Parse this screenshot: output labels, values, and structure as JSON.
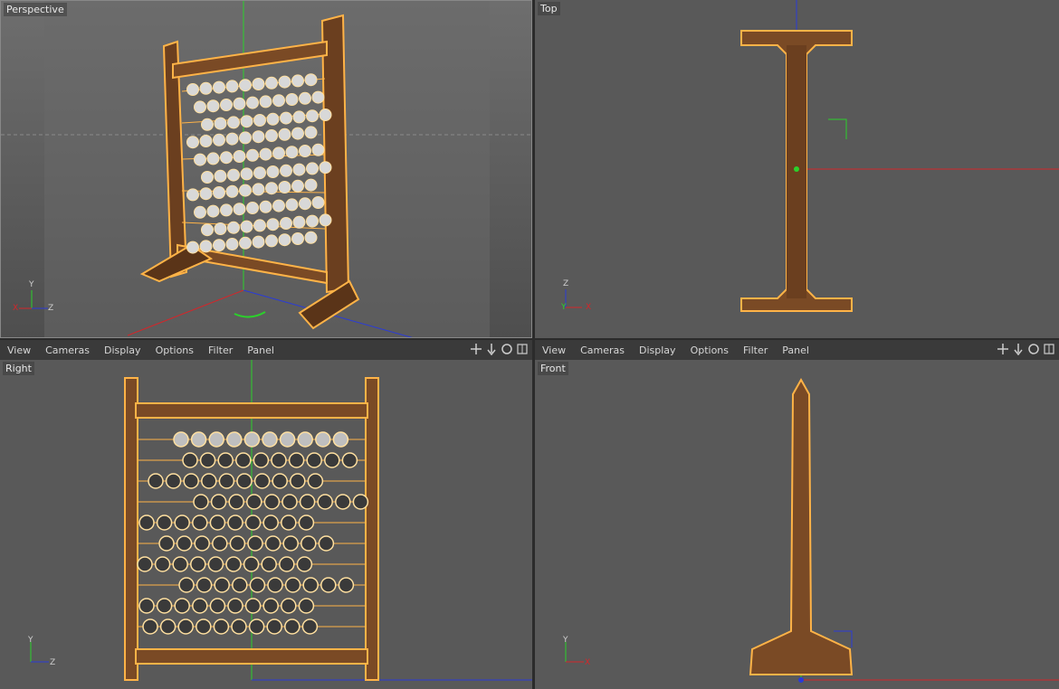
{
  "viewports": {
    "perspective": {
      "label": "Perspective"
    },
    "top": {
      "label": "Top"
    },
    "right": {
      "label": "Right"
    },
    "front": {
      "label": "Front"
    }
  },
  "menus": {
    "left": [
      "View",
      "Cameras",
      "Display",
      "Options",
      "Filter",
      "Panel"
    ],
    "right": [
      "View",
      "Cameras",
      "Display",
      "Options",
      "Filter",
      "Panel"
    ]
  },
  "tools": [
    "move-icon",
    "arrow-down-icon",
    "rotate-icon",
    "maximize-icon"
  ],
  "gizmos": {
    "perspective": {
      "up": "Y",
      "side": "Z",
      "left": "X"
    },
    "top": {
      "up": "Z",
      "left": "Y",
      "side": "X"
    },
    "right": {
      "up": "Y",
      "side": "Z"
    },
    "front": {
      "up": "Y",
      "side": "X"
    }
  },
  "colors": {
    "viewport_bg": "#595959",
    "wood": "#7a4a25",
    "highlight": "#ffb347",
    "axis_x": "#d4262a",
    "axis_y": "#2bd12b",
    "axis_z": "#2a3bd8"
  }
}
